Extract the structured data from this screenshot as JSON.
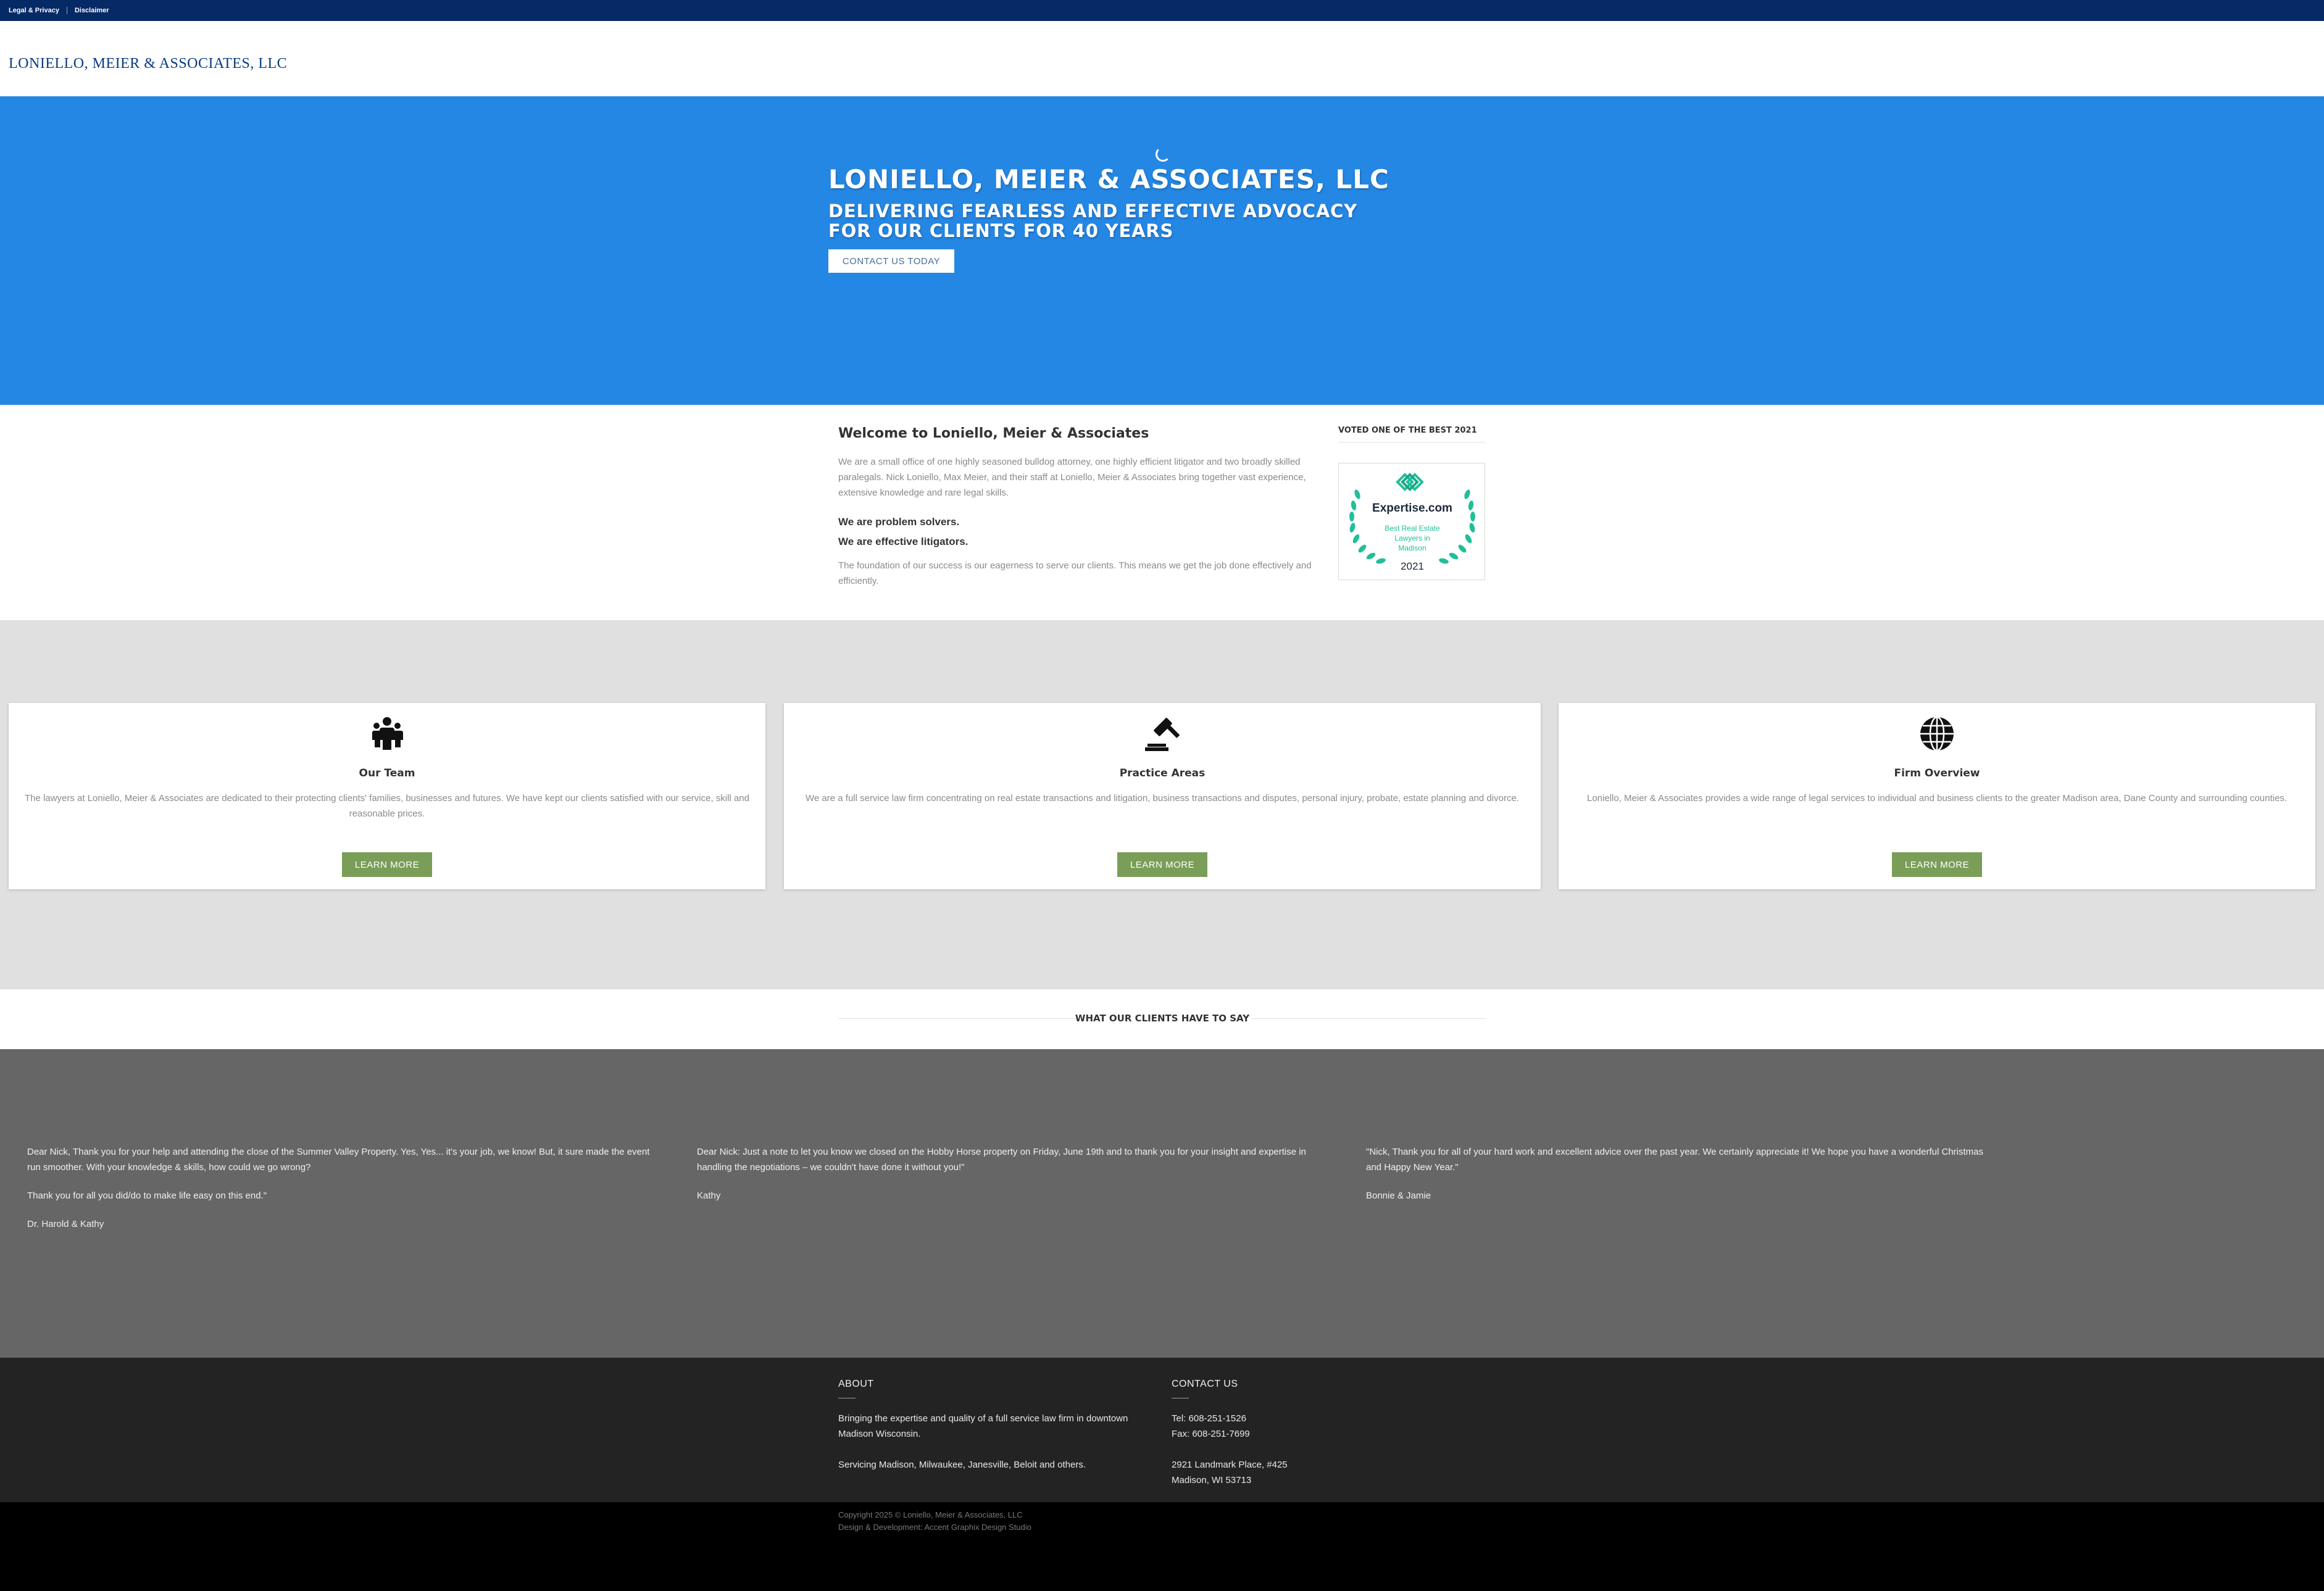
{
  "topbar": {
    "links": [
      "Legal & Privacy",
      "Disclaimer"
    ]
  },
  "header": {
    "logo": "LONIELLO, MEIER & ASSOCIATES, LLC"
  },
  "hero": {
    "title": "LONIELLO, MEIER & ASSOCIATES, LLC",
    "subtitle": "DELIVERING FEARLESS AND EFFECTIVE ADVOCACY FOR OUR CLIENTS FOR 40 YEARS",
    "button": "CONTACT US TODAY"
  },
  "welcome": {
    "title": "Welcome to Loniello, Meier & Associates",
    "intro": "We are a small office of one highly seasoned bulldog attorney, one highly efficient litigator and two broadly skilled paralegals. Nick Loniello, Max Meier, and their staff at Loniello, Meier & Associates bring together vast experience, extensive knowledge and rare legal skills.",
    "strong1": "We are problem solvers.",
    "strong2": "We are effective litigators.",
    "closing": "The foundation of our success is our eagerness to serve our clients. This means we get the job done effectively and efficiently."
  },
  "voted": {
    "title": "VOTED ONE OF THE BEST 2021",
    "badge": {
      "brand": "Expertise.com",
      "line1": "Best Real Estate",
      "line2": "Lawyers in",
      "line3": "Madison",
      "year": "2021",
      "accent_color": "#1fbf9a"
    }
  },
  "cards": [
    {
      "icon": "team-icon",
      "title": "Our Team",
      "text": "The lawyers at Loniello, Meier & Associates are dedicated to their protecting clients' families, businesses and futures. We have kept our clients satisfied with our service, skill and reasonable prices.",
      "button": "LEARN MORE"
    },
    {
      "icon": "gavel-icon",
      "title": "Practice Areas",
      "text": "We are a full service law firm concentrating on real estate transactions and litigation, business transactions and disputes, personal injury, probate, estate planning and divorce.",
      "button": "LEARN MORE"
    },
    {
      "icon": "globe-icon",
      "title": "Firm Overview",
      "text": "Loniello, Meier & Associates provides a wide range of legal services to individual and business clients to the greater Madison area, Dane County and surrounding counties.",
      "button": "LEARN MORE"
    }
  ],
  "clients": {
    "heading": "WHAT OUR CLIENTS HAVE TO SAY",
    "testimonials": [
      {
        "paragraphs": [
          "Dear Nick, Thank you for your help and attending the close of the Summer Valley Property. Yes, Yes... it's your job, we know! But, it sure made the event run smoother. With your knowledge & skills, how could we go wrong?",
          "Thank you for all you did/do to make life easy on this end.\"",
          "Dr. Harold & Kathy"
        ]
      },
      {
        "paragraphs": [
          "Dear Nick: Just a note to let you know we closed on the Hobby Horse property on Friday, June 19th and to thank you for your insight and expertise in handling the negotiations – we couldn't have done it without you!\"",
          "Kathy"
        ]
      },
      {
        "paragraphs": [
          "\"Nick, Thank you for all of your hard work and excellent advice over the past year. We certainly appreciate it! We hope you have a wonderful Christmas and Happy New Year.\"",
          "Bonnie & Jamie"
        ]
      }
    ]
  },
  "footer": {
    "about": {
      "heading": "ABOUT",
      "line1": "Bringing the expertise and quality of a full service law firm in downtown Madison Wisconsin.",
      "line2": "Servicing Madison, Milwaukee, Janesville, Beloit and others."
    },
    "contact": {
      "heading": "CONTACT US",
      "tel": "Tel: 608-251-1526",
      "fax": "Fax: 608-251-7699",
      "address1": "2921 Landmark Place, #425",
      "address2": "Madison, WI 53713"
    },
    "copyright": "Copyright 2025 © Loniello, Meier & Associates, LLC",
    "credit": "Design & Development: Accent Graphix Design Studio"
  },
  "colors": {
    "topbar": "#062a66",
    "hero": "#2587e4",
    "button_green": "#7a9e58",
    "testimonial_bg": "#666666",
    "footer_bg": "#232323"
  }
}
